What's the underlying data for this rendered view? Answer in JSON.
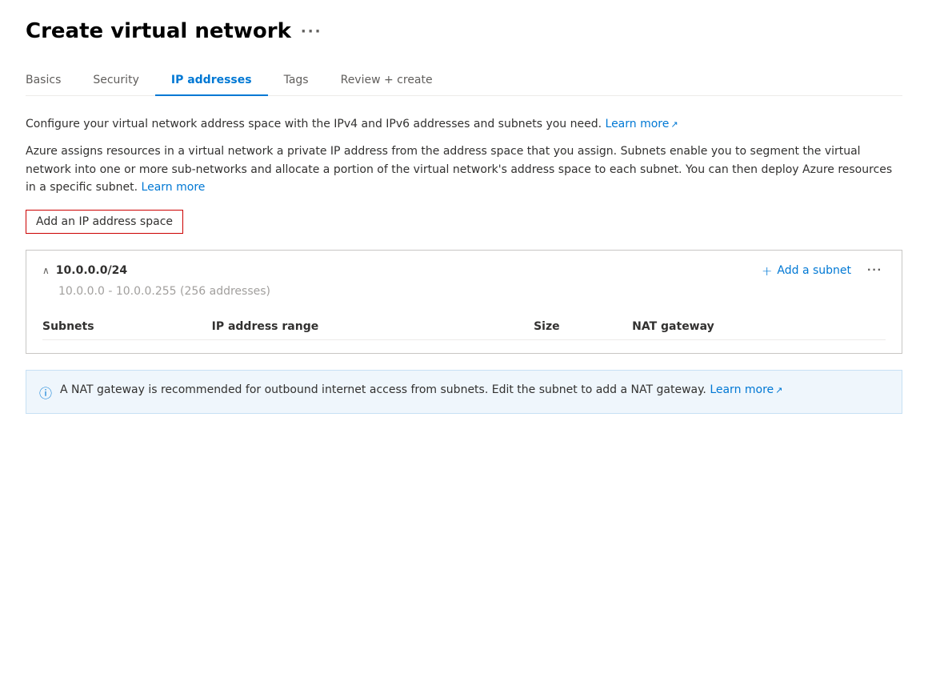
{
  "header": {
    "title": "Create virtual network",
    "more_icon": "···"
  },
  "tabs": [
    {
      "id": "basics",
      "label": "Basics",
      "active": false
    },
    {
      "id": "security",
      "label": "Security",
      "active": false
    },
    {
      "id": "ip-addresses",
      "label": "IP addresses",
      "active": true
    },
    {
      "id": "tags",
      "label": "Tags",
      "active": false
    },
    {
      "id": "review-create",
      "label": "Review + create",
      "active": false
    }
  ],
  "description1": "Configure your virtual network address space with the IPv4 and IPv6 addresses and subnets you need.",
  "learn_more_1": "Learn more",
  "description2": "Azure assigns resources in a virtual network a private IP address from the address space that you assign. Subnets enable you to segment the virtual network into one or more sub-networks and allocate a portion of the virtual network's address space to each subnet. You can then deploy Azure resources in a specific subnet.",
  "learn_more_2": "Learn more",
  "add_ip_button": "Add an IP address space",
  "ip_space": {
    "cidr": "10.0.0.0/24",
    "range": "10.0.0.0 - 10.0.0.255 (256 addresses)",
    "add_subnet_label": "Add a subnet",
    "ellipsis": "···",
    "table_headers": [
      "Subnets",
      "IP address range",
      "Size",
      "NAT gateway"
    ],
    "rows": []
  },
  "info_banner": {
    "text": "A NAT gateway is recommended for outbound internet access from subnets. Edit the subnet to add a NAT gateway.",
    "learn_more": "Learn more"
  }
}
